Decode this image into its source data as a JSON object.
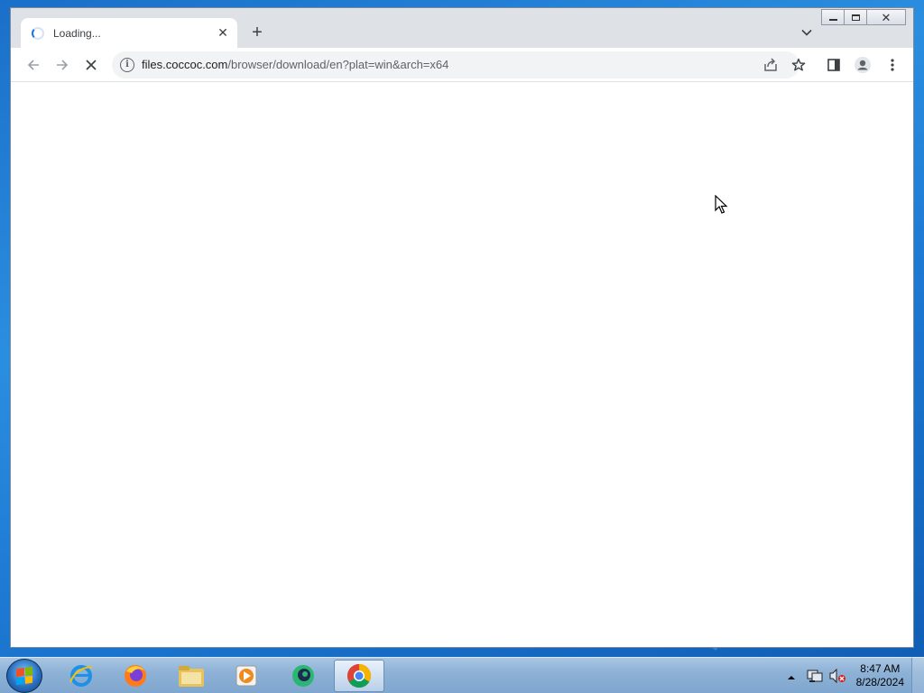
{
  "browser": {
    "tab": {
      "title": "Loading...",
      "close_icon": "close-icon"
    },
    "new_tab_label": "+",
    "address": {
      "host": "files.coccoc.com",
      "path": "/browser/download/en?plat=win&arch=x64"
    }
  },
  "taskbar": {
    "apps": [
      "internet-explorer-icon",
      "firefox-icon",
      "file-explorer-icon",
      "media-player-icon",
      "coccoc-icon",
      "chrome-icon"
    ],
    "active_app": "chrome-icon",
    "time": "8:47 AM",
    "date": "8/28/2024"
  },
  "colors": {
    "accent": "#1a73e8",
    "taskbar": "#8eb2d6",
    "desktop": "#1c78d2"
  }
}
